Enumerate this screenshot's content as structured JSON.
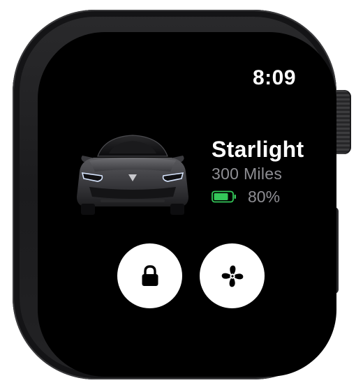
{
  "status_bar": {
    "time": "8:09"
  },
  "vehicle": {
    "name": "Starlight",
    "range": "300 Miles",
    "battery_percent_label": "80%",
    "battery_level": 0.8
  },
  "actions": {
    "lock_icon": "lock-icon",
    "fan_icon": "fan-icon"
  },
  "colors": {
    "screen_bg": "#000000",
    "primary_text": "#ffffff",
    "secondary_text": "#8e8e93",
    "battery_fill": "#34c759",
    "button_bg": "#ffffff"
  }
}
